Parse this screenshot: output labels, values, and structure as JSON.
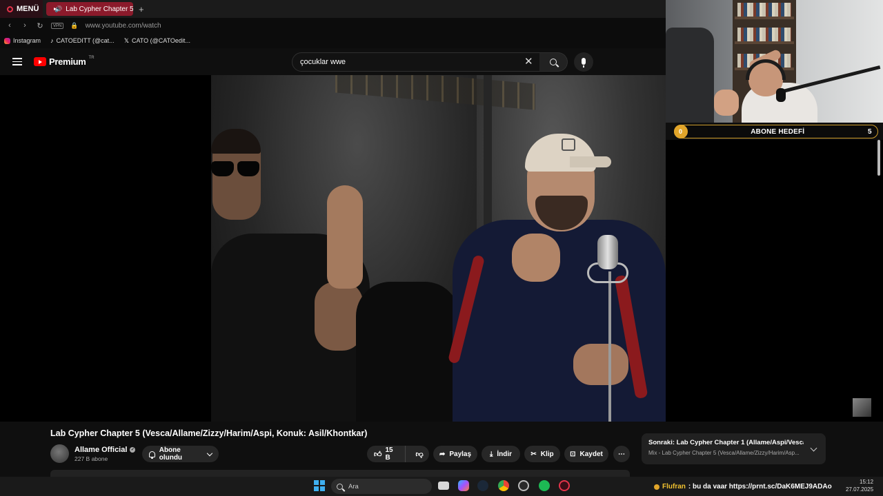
{
  "browser": {
    "menu_label": "MENÜ",
    "active_tab": "Lab Cypher Chapter 5",
    "new_tab_icon": "plus-icon",
    "vpn_badge": "VPN",
    "url": "www.youtube.com/watch",
    "bookmarks": [
      {
        "label": "Instagram",
        "icon": "instagram-icon"
      },
      {
        "label": "CATOEDITT (@cat...",
        "icon": "tiktok-icon"
      },
      {
        "label": "CATO (@CATOedit...",
        "icon": "x-icon"
      }
    ]
  },
  "youtube": {
    "logo_text": "Premium",
    "region": "TR",
    "search_value": "çocuklar wwe",
    "accent": "#ff0000"
  },
  "video": {
    "title": "Lab Cypher Chapter 5 (Vesca/Allame/Zizzy/Harim/Aspi, Konuk: Asil/Khontkar)",
    "channel_name": "Allame Official",
    "subscribers": "227 B abone",
    "subscribe_label": "Abone olundu",
    "like_count": "15 B",
    "share_label": "Paylaş",
    "download_label": "İndir",
    "clip_label": "Klip",
    "save_label": "Kaydet"
  },
  "up_next": {
    "title": "Sonraki: Lab Cypher Chapter 1 (Allame/Aspi/Vesca...",
    "subtitle": "Mix - Lab Cypher Chapter 5 (Vesca/Allame/Zizzy/Harim/Asp..."
  },
  "stream_overlay": {
    "goal_label": "ABONE HEDEFİ",
    "goal_current": "0",
    "goal_target": "5",
    "goal_color": "#e1a52a"
  },
  "taskbar": {
    "search_placeholder": "Ara",
    "chat_user": "Flufran",
    "chat_message": ": bu da vaar https://prnt.sc/DaK6MEJ9ADAo",
    "time": "15:12",
    "date": "27.07.2025"
  }
}
